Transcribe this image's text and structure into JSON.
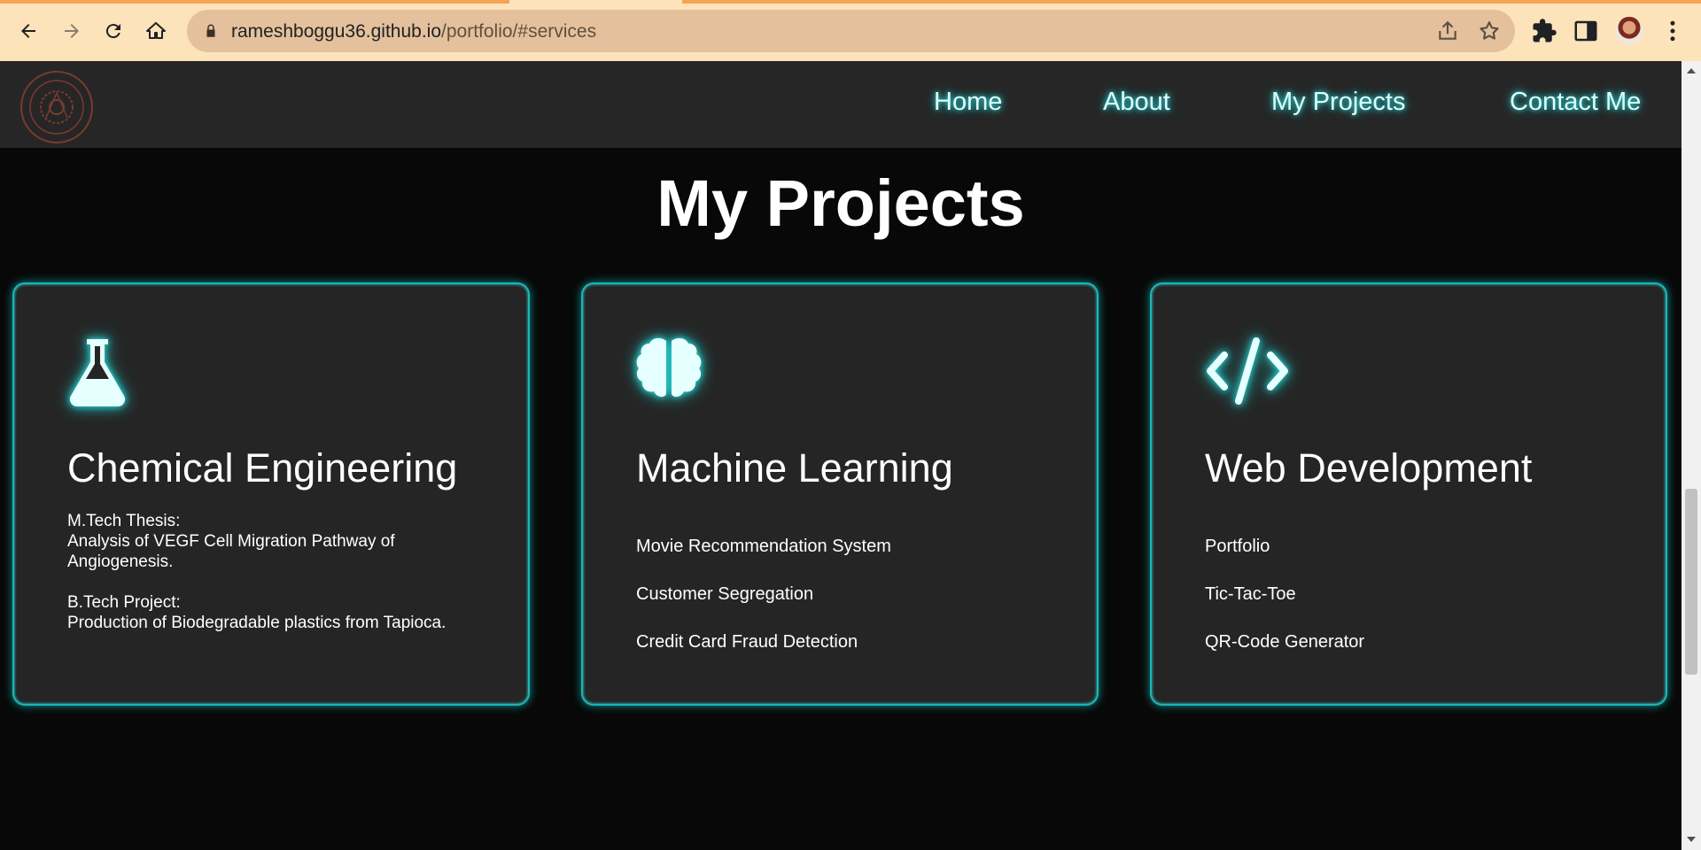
{
  "browser": {
    "url_host": "rameshboggu36.github.io",
    "url_path": "/portfolio/#services",
    "icons": [
      "back-icon",
      "forward-icon",
      "reload-icon",
      "home-icon",
      "lock-icon",
      "share-icon",
      "star-icon",
      "extensions-icon",
      "side-panel-icon",
      "profile-avatar",
      "menu-icon"
    ]
  },
  "nav": {
    "logo": "institute-seal-logo",
    "links": [
      "Home",
      "About",
      "My Projects",
      "Contact Me"
    ]
  },
  "section": {
    "title": "My Projects"
  },
  "cards": [
    {
      "icon": "flask-icon",
      "title": "Chemical Engineering",
      "mtech_label": "M.Tech Thesis:",
      "mtech_line1": "Analysis of VEGF Cell Migration Pathway of",
      "mtech_line2": "Angiogenesis.",
      "btech_label": "B.Tech Project:",
      "btech_line1": "Production of Biodegradable plastics from Tapioca."
    },
    {
      "icon": "brain-icon",
      "title": "Machine Learning",
      "items": [
        "Movie Recommendation System",
        "Customer Segregation",
        "Credit Card Fraud Detection"
      ]
    },
    {
      "icon": "code-icon",
      "title": "Web Development",
      "items": [
        "Portfolio",
        "Tic-Tac-Toe",
        "QR-Code Generator"
      ]
    }
  ],
  "colors": {
    "accent_glow": "#2fe0e0",
    "card_bg": "#252525",
    "page_bg": "#080808",
    "chrome_bg": "#fde3b9"
  }
}
